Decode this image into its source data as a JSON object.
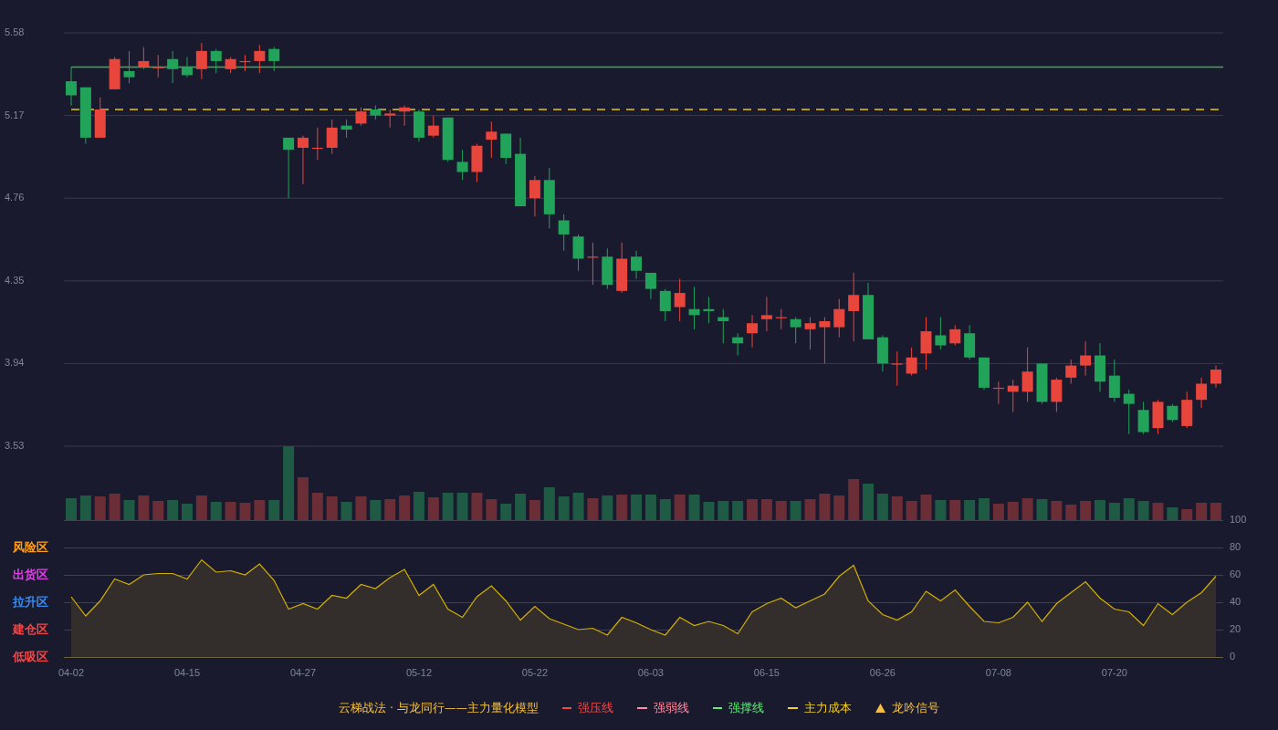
{
  "price_panel": {
    "chart_data": {
      "type": "candlestick",
      "grid": true,
      "ylim": [
        3.53,
        5.58
      ],
      "yticks": [
        {
          "value": 5.58,
          "label": "5.58"
        },
        {
          "value": 5.17,
          "label": "5.17"
        },
        {
          "value": 4.76,
          "label": "4.76"
        },
        {
          "value": 4.35,
          "label": "4.35"
        },
        {
          "value": 3.94,
          "label": "3.94"
        },
        {
          "value": 3.53,
          "label": "3.53"
        }
      ],
      "ohlc": [
        [
          5.34,
          5.41,
          5.22,
          5.27
        ],
        [
          5.31,
          5.31,
          5.03,
          5.06
        ],
        [
          5.06,
          5.26,
          5.06,
          5.2
        ],
        [
          5.3,
          5.46,
          5.3,
          5.45
        ],
        [
          5.39,
          5.49,
          5.33,
          5.36
        ],
        [
          5.41,
          5.51,
          5.4,
          5.44
        ],
        [
          5.41,
          5.47,
          5.36,
          5.41
        ],
        [
          5.45,
          5.49,
          5.33,
          5.4
        ],
        [
          5.41,
          5.46,
          5.36,
          5.37
        ],
        [
          5.4,
          5.53,
          5.35,
          5.49
        ],
        [
          5.49,
          5.5,
          5.38,
          5.44
        ],
        [
          5.4,
          5.46,
          5.38,
          5.45
        ],
        [
          5.44,
          5.47,
          5.39,
          5.44
        ],
        [
          5.44,
          5.52,
          5.38,
          5.49
        ],
        [
          5.5,
          5.51,
          5.39,
          5.44
        ],
        [
          5.06,
          5.06,
          4.76,
          5.0
        ],
        [
          5.01,
          5.07,
          4.83,
          5.06
        ],
        [
          5.01,
          5.11,
          4.95,
          5.01
        ],
        [
          5.01,
          5.15,
          4.98,
          5.11
        ],
        [
          5.12,
          5.15,
          5.06,
          5.1
        ],
        [
          5.13,
          5.21,
          5.12,
          5.19
        ],
        [
          5.2,
          5.22,
          5.15,
          5.17
        ],
        [
          5.17,
          5.2,
          5.11,
          5.18
        ],
        [
          5.19,
          5.22,
          5.12,
          5.21
        ],
        [
          5.19,
          5.2,
          5.04,
          5.06
        ],
        [
          5.07,
          5.17,
          5.06,
          5.12
        ],
        [
          5.16,
          5.16,
          4.94,
          4.95
        ],
        [
          4.94,
          5.0,
          4.85,
          4.89
        ],
        [
          4.89,
          5.03,
          4.84,
          5.02
        ],
        [
          5.05,
          5.14,
          4.96,
          5.09
        ],
        [
          5.08,
          5.08,
          4.93,
          4.96
        ],
        [
          4.98,
          5.06,
          4.72,
          4.72
        ],
        [
          4.76,
          4.87,
          4.67,
          4.85
        ],
        [
          4.85,
          4.91,
          4.61,
          4.68
        ],
        [
          4.65,
          4.68,
          4.5,
          4.58
        ],
        [
          4.57,
          4.58,
          4.4,
          4.46
        ],
        [
          4.47,
          4.54,
          4.33,
          4.47
        ],
        [
          4.47,
          4.51,
          4.31,
          4.33
        ],
        [
          4.3,
          4.54,
          4.29,
          4.46
        ],
        [
          4.47,
          4.5,
          4.36,
          4.4
        ],
        [
          4.39,
          4.39,
          4.26,
          4.31
        ],
        [
          4.3,
          4.31,
          4.15,
          4.2
        ],
        [
          4.22,
          4.36,
          4.15,
          4.29
        ],
        [
          4.21,
          4.32,
          4.11,
          4.18
        ],
        [
          4.21,
          4.27,
          4.14,
          4.2
        ],
        [
          4.17,
          4.21,
          4.04,
          4.15
        ],
        [
          4.07,
          4.09,
          3.98,
          4.04
        ],
        [
          4.09,
          4.18,
          4.02,
          4.14
        ],
        [
          4.16,
          4.27,
          4.1,
          4.18
        ],
        [
          4.17,
          4.21,
          4.11,
          4.17
        ],
        [
          4.16,
          4.17,
          4.04,
          4.12
        ],
        [
          4.11,
          4.17,
          4.01,
          4.14
        ],
        [
          4.12,
          4.17,
          3.94,
          4.15
        ],
        [
          4.12,
          4.26,
          4.07,
          4.21
        ],
        [
          4.2,
          4.39,
          4.05,
          4.28
        ],
        [
          4.28,
          4.34,
          4.06,
          4.06
        ],
        [
          4.07,
          4.08,
          3.9,
          3.94
        ],
        [
          3.94,
          4.0,
          3.83,
          3.94
        ],
        [
          3.89,
          4.02,
          3.88,
          3.97
        ],
        [
          3.99,
          4.17,
          3.91,
          4.1
        ],
        [
          4.08,
          4.17,
          4.01,
          4.03
        ],
        [
          4.04,
          4.13,
          4.03,
          4.11
        ],
        [
          4.09,
          4.13,
          3.96,
          3.97
        ],
        [
          3.97,
          3.97,
          3.81,
          3.82
        ],
        [
          3.82,
          3.85,
          3.74,
          3.82
        ],
        [
          3.8,
          3.86,
          3.7,
          3.83
        ],
        [
          3.8,
          4.02,
          3.75,
          3.9
        ],
        [
          3.94,
          3.94,
          3.74,
          3.75
        ],
        [
          3.75,
          3.87,
          3.7,
          3.86
        ],
        [
          3.87,
          3.96,
          3.84,
          3.93
        ],
        [
          3.93,
          4.05,
          3.88,
          3.98
        ],
        [
          3.98,
          4.04,
          3.8,
          3.85
        ],
        [
          3.88,
          3.96,
          3.75,
          3.77
        ],
        [
          3.79,
          3.81,
          3.59,
          3.74
        ],
        [
          3.71,
          3.75,
          3.59,
          3.6
        ],
        [
          3.62,
          3.76,
          3.59,
          3.75
        ],
        [
          3.73,
          3.74,
          3.65,
          3.66
        ],
        [
          3.63,
          3.8,
          3.62,
          3.76
        ],
        [
          3.76,
          3.87,
          3.72,
          3.84
        ],
        [
          3.84,
          3.93,
          3.82,
          3.91
        ]
      ]
    }
  },
  "oscillator_panel": {
    "date_labels": [
      "04-02",
      "04-15",
      "04-27",
      "05-12",
      "05-22",
      "06-03",
      "06-15",
      "06-26",
      "07-08",
      "07-20"
    ],
    "zones": [
      {
        "label": "风险区",
        "color": "#ff9f1a"
      },
      {
        "label": "出货区",
        "color": "#e040e8"
      },
      {
        "label": "拉升区",
        "color": "#3a8cf0"
      },
      {
        "label": "建仓区",
        "color": "#f04848"
      },
      {
        "label": "低吸区",
        "color": "#f04848"
      }
    ],
    "chart_data": {
      "type": "area",
      "grid": true,
      "ylim": [
        0,
        100
      ],
      "yticks": [
        {
          "value": 100,
          "label": "100"
        },
        {
          "value": 80,
          "label": "80"
        },
        {
          "value": 60,
          "label": "60"
        },
        {
          "value": 40,
          "label": "40"
        },
        {
          "value": 20,
          "label": "20"
        },
        {
          "value": 0,
          "label": "0"
        }
      ],
      "series": [
        {
          "color": "#d2b000",
          "values": [
            44,
            30,
            41,
            57,
            53,
            60,
            61,
            61,
            57,
            71,
            62,
            63,
            60,
            68,
            56,
            35,
            39,
            35,
            45,
            43,
            53,
            50,
            58,
            64,
            45,
            53,
            35,
            29,
            44,
            52,
            41,
            27,
            37,
            28,
            24,
            20,
            21,
            16,
            29,
            25,
            20,
            16,
            29,
            23,
            26,
            23,
            17,
            33,
            39,
            43,
            36,
            41,
            46,
            59,
            67,
            41,
            31,
            27,
            33,
            48,
            41,
            49,
            37,
            26,
            25,
            29,
            40,
            26,
            39,
            47,
            55,
            43,
            35,
            33,
            23,
            39,
            31,
            40,
            47,
            59
          ]
        }
      ]
    }
  },
  "legend": {
    "title": "云梯战法 · 与龙同行——主力量化模型",
    "items": [
      {
        "kind": "line",
        "label": "强压线",
        "color": "#f04848"
      },
      {
        "kind": "dashed",
        "label": "强弱线",
        "color": "#ff8fa3"
      },
      {
        "kind": "line",
        "label": "强撑线",
        "color": "#5cf070"
      },
      {
        "kind": "dashed",
        "label": "主力成本",
        "color": "#f5d020"
      },
      {
        "kind": "triangle",
        "label": "龙吟信号",
        "color": "#f5c040"
      }
    ]
  }
}
